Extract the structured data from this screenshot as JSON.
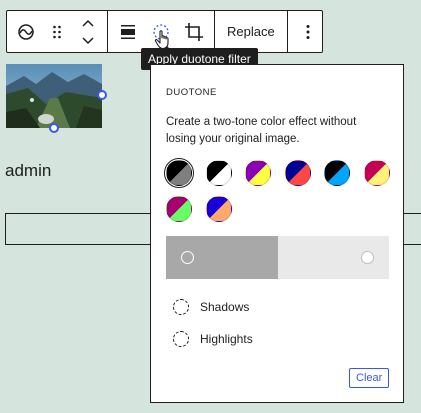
{
  "toolbar": {
    "groups": [
      {
        "buttons": [
          "duotone-icon",
          "drag-handle-icon",
          "move-up-down-icon"
        ]
      },
      {
        "buttons": [
          "align-icon",
          "duotone-filter-icon",
          "crop-icon"
        ]
      },
      {
        "buttons": [
          "replace"
        ]
      },
      {
        "buttons": [
          "more-options-icon"
        ]
      }
    ],
    "replace_label": "Replace"
  },
  "tooltip": {
    "text": "Apply duotone filter"
  },
  "block": {
    "author": "admin"
  },
  "duotone": {
    "title": "DUOTONE",
    "description": "Create a two-tone color effect without losing your original image.",
    "swatches": [
      {
        "name": "grayscale",
        "colors": [
          "#000000",
          "#7f7f7f"
        ],
        "selected": true
      },
      {
        "name": "dark-grayscale",
        "colors": [
          "#000000",
          "#ffffff"
        ]
      },
      {
        "name": "purple-yellow",
        "colors": [
          "#8c00b7",
          "#fcff41"
        ]
      },
      {
        "name": "blue-red",
        "colors": [
          "#000097",
          "#ff4747"
        ]
      },
      {
        "name": "midnight",
        "colors": [
          "#000000",
          "#00a5ff"
        ]
      },
      {
        "name": "magenta-yellow",
        "colors": [
          "#c7005a",
          "#fff278"
        ]
      },
      {
        "name": "purple-green",
        "colors": [
          "#a60072",
          "#67ff66"
        ]
      },
      {
        "name": "blue-orange",
        "colors": [
          "#1900d8",
          "#ffa96b"
        ]
      }
    ],
    "slider": {
      "shadow_color": "#a8a8a8",
      "highlight_color": "#e9e9e9",
      "split_fraction": 0.5
    },
    "options": [
      {
        "label": "Shadows"
      },
      {
        "label": "Highlights"
      }
    ],
    "clear_label": "Clear"
  },
  "colors": {
    "accent": "#3858e9",
    "background": "#d5e4dc",
    "border": "#1e1e1e"
  }
}
